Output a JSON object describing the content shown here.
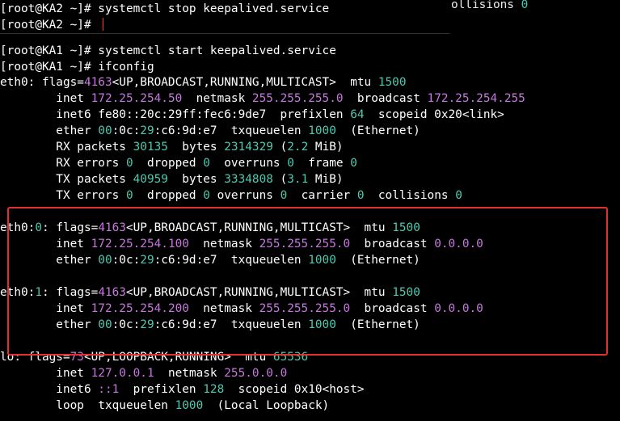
{
  "top_terminal": {
    "line1_prompt": "[root@KA2 ~]# ",
    "line1_command": "systemctl stop keepalived.service",
    "line2_prompt": "[root@KA2 ~]# ",
    "ghost_text": "ollisions ",
    "ghost_num": "0"
  },
  "bottom_terminal": {
    "cmd1_prompt": "[root@KA1 ~]# ",
    "cmd1_command": "systemctl start keepalived.service",
    "cmd2_prompt": "[root@KA1 ~]# ",
    "cmd2_command": "ifconfig",
    "eth0": {
      "name": "eth0: ",
      "flags_label": "flags=",
      "flags_num": "4163",
      "flags_set": "<UP,BROADCAST,RUNNING,MULTICAST>  mtu ",
      "mtu": "1500",
      "inet_label": "        inet ",
      "inet": "172.25.254.50",
      "netmask_label": "  netmask ",
      "netmask": "255.255.255.0",
      "broadcast_label": "  broadcast ",
      "broadcast": "172.25.254.255",
      "inet6_label": "        inet6 fe80::20c:29ff:fec6:9de7  prefixlen ",
      "prefixlen": "64",
      "scopeid": "  scopeid 0x20<link>",
      "ether_label": "        ether ",
      "ether_a": "00",
      "ether_b": ":0c:",
      "ether_c": "29",
      "ether_d": ":c6:9d:e7  txqueuelen ",
      "txq": "1000",
      "ether_type": "  (Ethernet)",
      "rx_packets_label": "        RX packets ",
      "rx_packets": "30135",
      "rx_bytes_label": "  bytes ",
      "rx_bytes": "2314329",
      "rx_size_a": " (",
      "rx_size_num": "2.2",
      "rx_size_b": " MiB)",
      "rx_errors_label": "        RX errors ",
      "rx_errors": "0",
      "rx_dropped_label": "  dropped ",
      "rx_dropped": "0",
      "rx_overruns_label": "  overruns ",
      "rx_overruns": "0",
      "rx_frame_label": "  frame ",
      "rx_frame": "0",
      "tx_packets_label": "        TX packets ",
      "tx_packets": "40959",
      "tx_bytes_label": "  bytes ",
      "tx_bytes": "3334808",
      "tx_size_a": " (",
      "tx_size_num": "3.1",
      "tx_size_b": " MiB)",
      "tx_errors_label": "        TX errors ",
      "tx_errors": "0",
      "tx_dropped_label": "  dropped ",
      "tx_dropped": "0",
      "tx_overruns_label": " overruns ",
      "tx_overruns": "0",
      "tx_carrier_label": "  carrier ",
      "tx_carrier": "0",
      "tx_collisions_label": "  collisions ",
      "tx_collisions": "0"
    },
    "eth0_0": {
      "name_a": "eth0:",
      "name_num": "0",
      "name_b": ": flags=",
      "flags_num": "4163",
      "flags_set": "<UP,BROADCAST,RUNNING,MULTICAST>  mtu ",
      "mtu": "1500",
      "inet_label": "        inet ",
      "inet": "172.25.254.100",
      "netmask_label": "  netmask ",
      "netmask": "255.255.255.0",
      "broadcast_label": "  broadcast ",
      "broadcast": "0.0.0.0",
      "ether_label": "        ether ",
      "ether_a": "00",
      "ether_b": ":0c:",
      "ether_c": "29",
      "ether_d": ":c6:9d:e7  txqueuelen ",
      "txq": "1000",
      "ether_type": "  (Ethernet)"
    },
    "eth0_1": {
      "name_a": "eth0:",
      "name_num": "1",
      "name_b": ": flags=",
      "flags_num": "4163",
      "flags_set": "<UP,BROADCAST,RUNNING,MULTICAST>  mtu ",
      "mtu": "1500",
      "inet_label": "        inet ",
      "inet": "172.25.254.200",
      "netmask_label": "  netmask ",
      "netmask": "255.255.255.0",
      "broadcast_label": "  broadcast ",
      "broadcast": "0.0.0.0",
      "ether_label": "        ether ",
      "ether_a": "00",
      "ether_b": ":0c:",
      "ether_c": "29",
      "ether_d": ":c6:9d:e7  txqueuelen ",
      "txq": "1000",
      "ether_type": "  (Ethernet)"
    },
    "lo": {
      "name": "lo: flags=",
      "flags_num": "73",
      "flags_set": "<UP,LOOPBACK,RUNNING>  mtu ",
      "mtu": "65536",
      "inet_label": "        inet ",
      "inet": "127.0.0.1",
      "netmask_label": "  netmask ",
      "netmask": "255.0.0.0",
      "inet6_label": "        inet6 ",
      "inet6": "::1",
      "prefixlen_label": "  prefixlen ",
      "prefixlen": "128",
      "scopeid": "  scopeid 0x10<host>",
      "loop_label": "        loop  txqueuelen ",
      "txq": "1000",
      "loop_type": "  (Local Loopback)"
    }
  },
  "colors": {
    "accent_cyan": "#4ec9b0",
    "accent_magenta": "#c678dd",
    "highlight_box": "#e03030",
    "cursor": "#ff3333"
  }
}
